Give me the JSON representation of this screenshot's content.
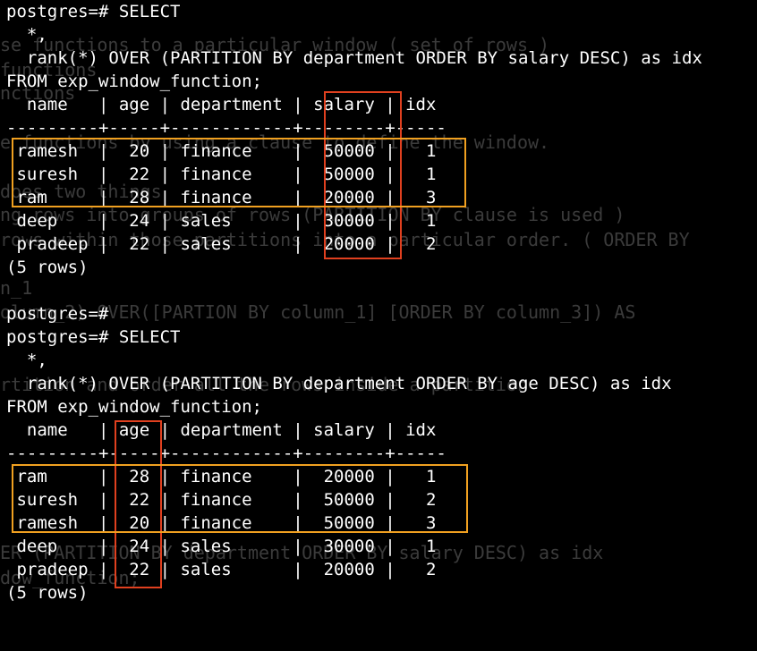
{
  "ghost_text": [
    "se functions to a particular window ( set of rows )",
    "functions",
    "nctions",
    "e functions by using a clause to define the window.",
    "does two things",
    "ng rows into groups of rows (PARTITION BY clause is used )",
    "rows within those partitions into a particular order. ( ORDER BY",
    "n_1",
    "olumn_2) OVER([PARTION BY column_1] [ORDER BY column_3]) AS",
    "rtition and order all the rows inside a partition",
    "ER (PARTITION BY department ORDER BY salary DESC) as idx",
    "dow_function;"
  ],
  "block1": {
    "prompt": "postgres=# SELECT",
    "line2": "  *,",
    "line3": "  rank(*) OVER (PARTITION BY department ORDER BY salary DESC) as idx",
    "line4": "FROM exp_window_function;",
    "header": "  name   | age | department | salary | idx",
    "separator": "---------+-----+------------+--------+-----",
    "rows": [
      " ramesh  |  20 | finance    |  50000 |   1",
      " suresh  |  22 | finance    |  50000 |   1",
      " ram     |  28 | finance    |  20000 |   3",
      " deep    |  24 | sales      |  30000 |   1",
      " pradeep |  22 | sales      |  20000 |   2"
    ],
    "count": "(5 rows)"
  },
  "blank_prompt": "postgres=#",
  "block2": {
    "prompt": "postgres=# SELECT",
    "line2": "  *,",
    "line3": "  rank(*) OVER (PARTITION BY department ORDER BY age DESC) as idx",
    "line4": "FROM exp_window_function;",
    "header": "  name   | age | department | salary | idx",
    "separator": "---------+-----+------------+--------+-----",
    "rows": [
      " ram     |  28 | finance    |  20000 |   1",
      " suresh  |  22 | finance    |  50000 |   2",
      " ramesh  |  20 | finance    |  50000 |   3",
      " deep    |  24 | sales      |  30000 |   1",
      " pradeep |  22 | sales      |  20000 |   2"
    ],
    "count": "(5 rows)"
  },
  "colors": {
    "background": "#000000",
    "text": "#ffffff",
    "ghost_text": "#3b3b3b",
    "highlight_red": "#e0401f",
    "highlight_orange": "#f0a020"
  }
}
